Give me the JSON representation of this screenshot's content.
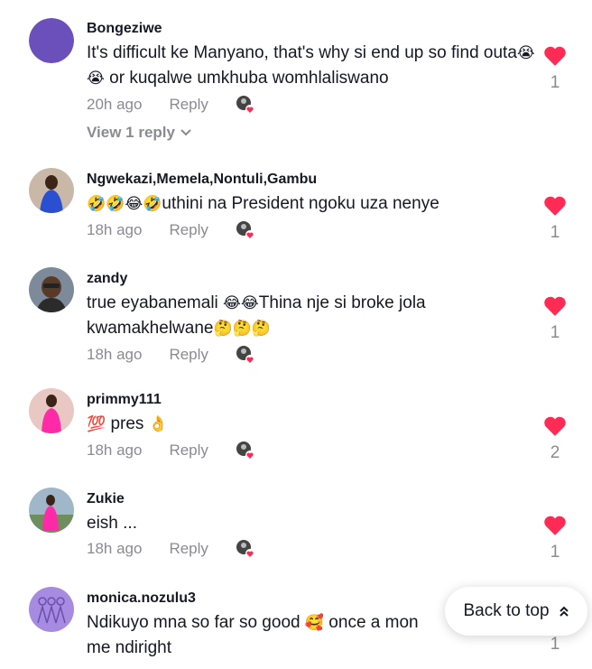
{
  "colors": {
    "like": "#fe2c55",
    "muted": "#8a8b91",
    "text": "#161823"
  },
  "comments": [
    {
      "username": "Bongeziwe",
      "text_parts": [
        "It's difficult ke Manyano, that's why si end up so find outa",
        "😭",
        "😭",
        " or kuqalwe umkhuba womhlaliswano"
      ],
      "time": "20h ago",
      "reply_label": "Reply",
      "likes": "1",
      "view_replies": "View 1 reply",
      "avatar_icon": "purple-circle"
    },
    {
      "username": "Ngwekazi,Memela,Nontuli,Gambu",
      "text_emoji": "🤣🤣😂🤣",
      "text": "uthini na President ngoku uza nenye",
      "time": "18h ago",
      "reply_label": "Reply",
      "likes": "1"
    },
    {
      "username": "zandy",
      "text_a": "true eyabanemali ",
      "text_emoji_a": "😂😂",
      "text_b": "Thina nje si broke jola kwamakhelwane",
      "text_emoji_b": "🤔🤔🤔",
      "time": "18h ago",
      "reply_label": "Reply",
      "likes": "1"
    },
    {
      "username": "primmy111",
      "text_emoji_a": "💯",
      "text": " pres ",
      "text_emoji_b": "👌",
      "time": "18h ago",
      "reply_label": "Reply",
      "likes": "2"
    },
    {
      "username": "Zukie",
      "text": "eish ...",
      "time": "18h ago",
      "reply_label": "Reply",
      "likes": "1"
    },
    {
      "username": "monica.nozulu3",
      "text_a": "Ndikuyo mna so far so good ",
      "text_emoji": "🥰",
      "text_b": " once a mon",
      "text_c": "me ndiright",
      "likes": "1"
    }
  ],
  "back_to_top": {
    "label": "Back to top",
    "icon": "double-chevron-up-icon"
  }
}
